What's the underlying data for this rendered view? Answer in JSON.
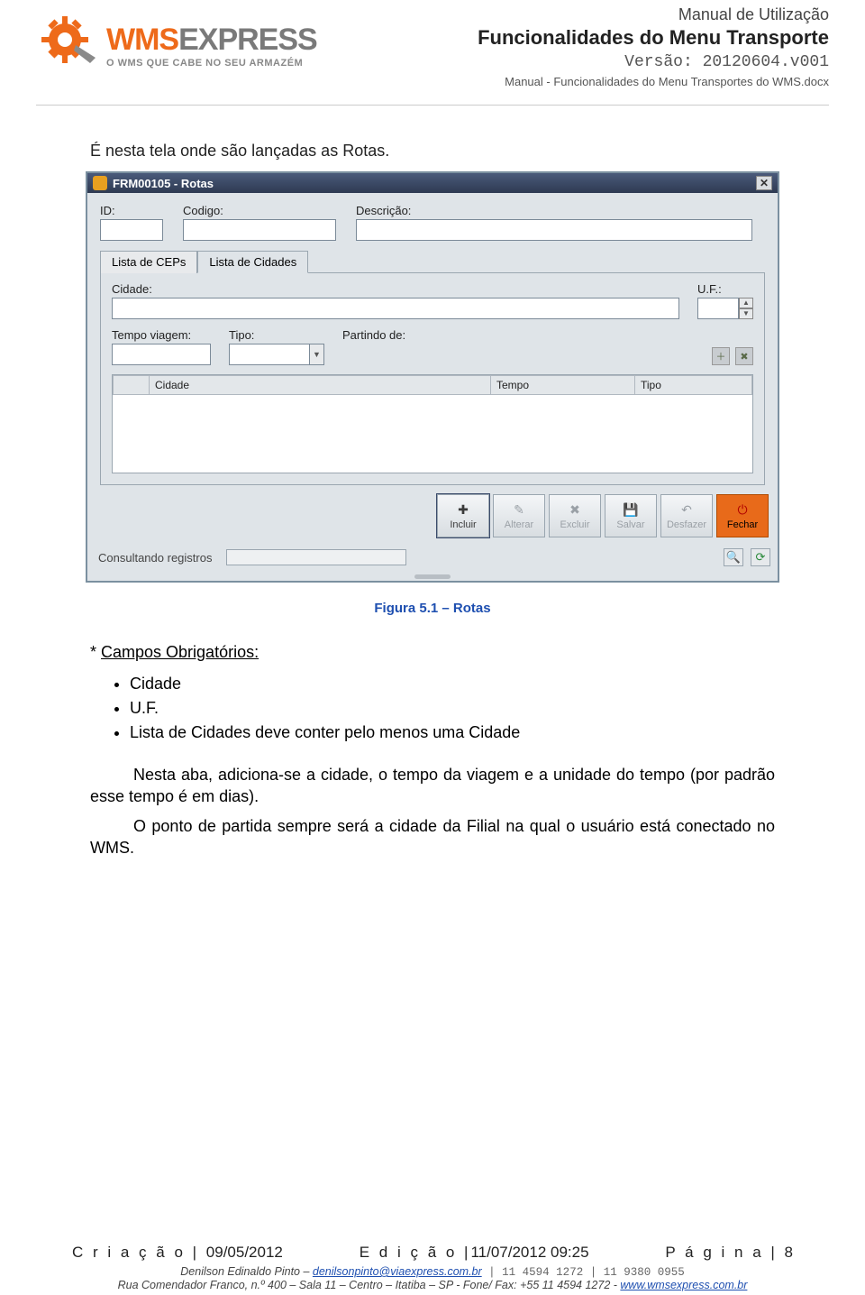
{
  "header": {
    "logo_brand1": "WMS",
    "logo_brand2": "EXPRESS",
    "slogan": "O WMS QUE CABE NO SEU ARMAZÉM",
    "title1": "Manual de Utilização",
    "title2": "Funcionalidades do Menu Transporte",
    "version": "Versão: 20120604.v001",
    "docname": "Manual - Funcionalidades do Menu Transportes do WMS.docx"
  },
  "intro": "É nesta tela onde são lançadas as Rotas.",
  "win": {
    "title": "FRM00105 - Rotas",
    "top": {
      "id_label": "ID:",
      "codigo_label": "Codigo:",
      "descricao_label": "Descrição:"
    },
    "tabs": {
      "t1": "Lista de CEPs",
      "t2": "Lista de Cidades"
    },
    "pane": {
      "cidade_label": "Cidade:",
      "uf_label": "U.F.:",
      "tempo_label": "Tempo viagem:",
      "tipo_label": "Tipo:",
      "partindo_label": "Partindo de:"
    },
    "grid": {
      "c0": "",
      "c1": "Cidade",
      "c2": "Tempo",
      "c3": "Tipo"
    },
    "toolbar": {
      "incluir": "Incluir",
      "alterar": "Alterar",
      "excluir": "Excluir",
      "salvar": "Salvar",
      "desfazer": "Desfazer",
      "fechar": "Fechar"
    },
    "status": "Consultando registros"
  },
  "caption": "Figura 5.1 – Rotas",
  "section": {
    "heading_prefix": "* ",
    "heading": "Campos Obrigatórios:",
    "bullets": [
      "Cidade",
      "U.F.",
      "Lista de Cidades deve conter pelo menos uma Cidade"
    ],
    "p1": "Nesta aba, adiciona-se a cidade, o tempo da viagem e a unidade do tempo (por padrão esse tempo é em dias).",
    "p2": "O ponto de partida sempre será a cidade da Filial na qual o usuário está conectado no WMS."
  },
  "footer": {
    "criacao_label": "C r i a ç ã o | ",
    "criacao_val": "09/05/2012",
    "edicao_label": "E d i ç ã o |",
    "edicao_val": "11/07/2012 09:25",
    "pagina_label": "P á g i n a | ",
    "pagina_val": "8",
    "line2_a": "Denilson Edinaldo Pinto – ",
    "line2_email": "denilsonpinto@viaexpress.com.br",
    "line2_b": " | 11 4594 1272 | 11 9380 0955",
    "line3_a": "Rua Comendador Franco, n.º 400 – Sala 11 – Centro – Itatiba – SP - Fone/ Fax: +55 11 4594 1272 - ",
    "line3_url": "www.wmsexpress.com.br"
  }
}
